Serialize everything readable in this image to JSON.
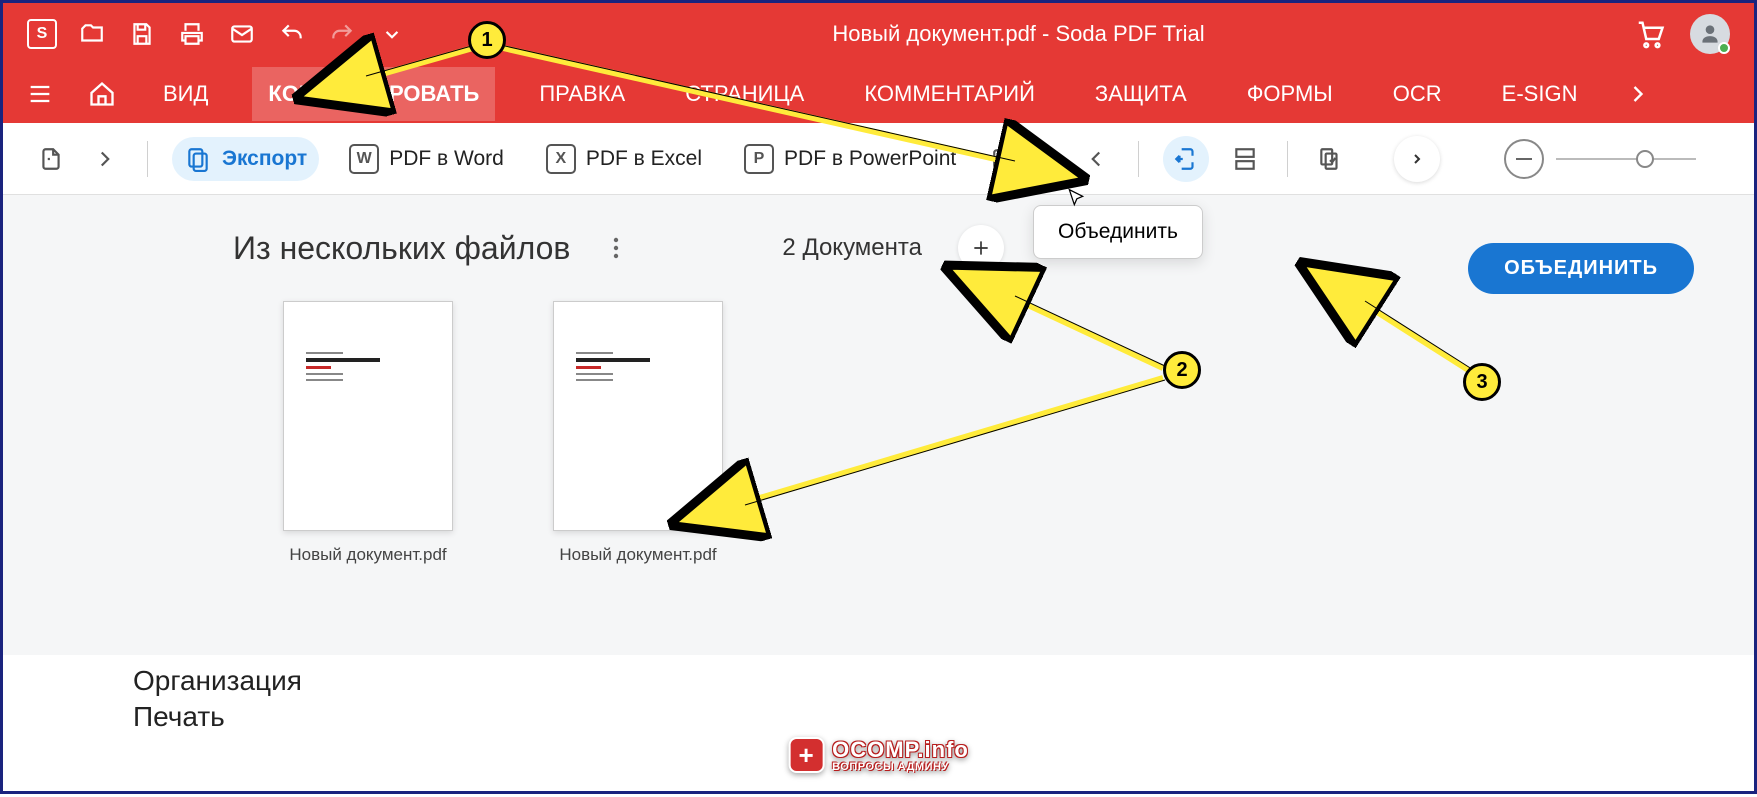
{
  "title": "Новый документ.pdf   -   Soda PDF Trial",
  "tabs": {
    "view": "ВИД",
    "convert": "КОНВЕРТИРОВАТЬ",
    "edit": "ПРАВКА",
    "page": "СТРАНИЦА",
    "comment": "КОММЕНТАРИЙ",
    "protect": "ЗАЩИТА",
    "forms": "ФОРМЫ",
    "ocr": "OCR",
    "esign": "E-SIGN"
  },
  "toolbar": {
    "export": "Экспорт",
    "pdf_to_word": "PDF в Word",
    "pdf_to_excel": "PDF в Excel",
    "pdf_to_ppt": "PDF в PowerPoint",
    "merge_tooltip": "Объединить"
  },
  "content": {
    "heading": "Из нескольких файлов",
    "doc_count_label": "2 Документа",
    "merge_button": "ОБЪЕДИНИТЬ",
    "files": [
      {
        "name": "Новый документ.pdf"
      },
      {
        "name": "Новый документ.pdf"
      }
    ]
  },
  "bottom": {
    "line1": "Организация",
    "line2": "Печать"
  },
  "watermark": {
    "main": "OCOMP.info",
    "sub": "ВОПРОСЫ АДМИНУ"
  },
  "annotations": {
    "n1": "1",
    "n2": "2",
    "n3": "3"
  }
}
